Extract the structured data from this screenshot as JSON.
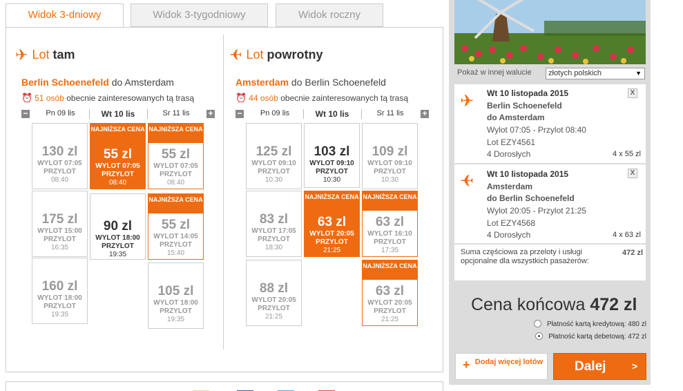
{
  "tabs": [
    {
      "label": "Widok 3-dniowy"
    },
    {
      "label": "Widok 3-tygodniowy"
    },
    {
      "label": "Widok roczny"
    }
  ],
  "outbound": {
    "lot": "Lot",
    "dir": "tam",
    "from": "Berlin Schoenefeld",
    "to_text": "do Amsterdam",
    "interest_count": "51 osób",
    "interest_text": "obecnie zainteresowanych tą trasą",
    "days": [
      "Pn 09 lis",
      "Wt 10 lis",
      "Sr 11 lis"
    ],
    "cells": [
      {
        "price": "130 zl",
        "dep": "WYLOT 07:05",
        "arr": "PRZYLOT",
        "arr_time": "08:40"
      },
      {
        "badge": "NAJNIŻSZA CENA",
        "price": "55 zl",
        "dep": "WYLOT 07:05",
        "arr": "PRZYLOT",
        "arr_time": "08:40"
      },
      {
        "badge": "NAJNIŻSZA CENA",
        "price": "55 zl",
        "dep": "WYLOT 07:05",
        "arr": "PRZYLOT",
        "arr_time": "08:40"
      },
      {
        "price": "175 zl",
        "dep": "WYLOT 15:00",
        "arr": "PRZYLOT",
        "arr_time": "16:35"
      },
      {
        "price": "90 zl",
        "dep": "WYLOT 18:00",
        "arr": "PRZYLOT",
        "arr_time": "19:35"
      },
      {
        "badge": "NAJNIŻSZA CENA",
        "price": "55 zl",
        "dep": "WYLOT 14:05",
        "arr": "PRZYLOT",
        "arr_time": "15:40"
      },
      {
        "price": "160 zl",
        "dep": "WYLOT 18:00",
        "arr": "PRZYLOT",
        "arr_time": "19:35"
      },
      {
        "price": "105 zl",
        "dep": "WYLOT 18:00",
        "arr": "PRZYLOT",
        "arr_time": "19:35"
      }
    ]
  },
  "inbound": {
    "lot": "Lot",
    "dir": "powrotny",
    "from": "Amsterdam",
    "to_text": "do Berlin Schoenefeld",
    "interest_count": "44 osób",
    "interest_text": "obecnie zainteresowanych tą trasą",
    "days": [
      "Pn 09 lis",
      "Wt 10 lis",
      "Sr 11 lis"
    ],
    "cells": [
      {
        "price": "125 zl",
        "dep": "WYLOT 09:10",
        "arr": "PRZYLOT",
        "arr_time": "10:30"
      },
      {
        "price": "103 zl",
        "dep": "WYLOT 09:10",
        "arr": "PRZYLOT",
        "arr_time": "10:30"
      },
      {
        "price": "109 zl",
        "dep": "WYLOT 09:10",
        "arr": "PRZYLOT",
        "arr_time": "10:30"
      },
      {
        "price": "83 zl",
        "dep": "WYLOT 17:05",
        "arr": "PRZYLOT",
        "arr_time": "18:30"
      },
      {
        "badge": "NAJNIŻSZA CENA",
        "price": "63 zl",
        "dep": "WYLOT 20:05",
        "arr": "PRZYLOT",
        "arr_time": "21:25"
      },
      {
        "badge": "NAJNIŻSZA CENA",
        "price": "63 zl",
        "dep": "WYLOT 16:10",
        "arr": "PRZYLOT",
        "arr_time": "17:35"
      },
      {
        "price": "88 zl",
        "dep": "WYLOT 20:05",
        "arr": "PRZYLOT",
        "arr_time": "21:25"
      },
      {
        "badge": "NAJNIŻSZA CENA",
        "price": "63 zl",
        "dep": "WYLOT 20:05",
        "arr": "PRZYLOT",
        "arr_time": "21:25"
      }
    ]
  },
  "summary": {
    "currency_label": "Pokaż w innej walucie",
    "currency_value": "złotych polskich",
    "flight1": {
      "date": "Wt 10 listopada 2015",
      "from": "Berlin Schoenefeld",
      "to": "do Amsterdam",
      "times": "Wylot 07:05 - Przylot 08:40",
      "code": "Lot EZY4561",
      "pax": "4 Dorosłych",
      "amount": "4 x 55 zl"
    },
    "flight2": {
      "date": "Wt 10 listopada 2015",
      "from": "Amsterdam",
      "to": "do Berlin Schoenefeld",
      "times": "Wylot 20:05 - Przylot 21:25",
      "code": "Lot EZY4568",
      "pax": "4 Dorosłych",
      "amount": "4 x 63 zl"
    },
    "close": "X",
    "subtotal_text": "Suma częściowa za przeloty i usługi opcjonalne dla wszystkich pasażerów:",
    "subtotal_value": "472 zl",
    "final_label": "Cena końcowa",
    "final_value": "472 zl",
    "pay_credit": "Płatność kartą kredytową: 480 zl",
    "pay_debit": "Płatność kartą debetową: 472 zl",
    "btn_more": "Dodaj więcej lotów",
    "btn_next": "Dalej",
    "btn_next_chev": ">"
  },
  "colors": {
    "accent": "#ef6b11"
  }
}
